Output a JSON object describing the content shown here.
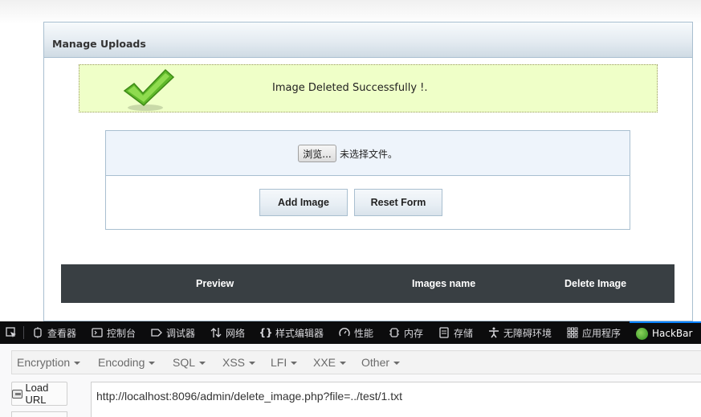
{
  "panel": {
    "title": "Manage Uploads"
  },
  "notification": {
    "message": "Image Deleted Successfully !.",
    "icon": "checkmark-icon"
  },
  "upload_form": {
    "browse_label": "浏览...",
    "no_file_text": "未选择文件。",
    "add_label": "Add Image",
    "reset_label": "Reset Form"
  },
  "table": {
    "columns": [
      "Preview",
      "Images name",
      "Delete Image"
    ]
  },
  "devtools": {
    "items": [
      {
        "label": "查看器",
        "icon": "inspector-icon"
      },
      {
        "label": "控制台",
        "icon": "console-icon"
      },
      {
        "label": "调试器",
        "icon": "debugger-icon"
      },
      {
        "label": "网络",
        "icon": "network-icon"
      },
      {
        "label": "样式编辑器",
        "icon": "style-editor-icon"
      },
      {
        "label": "性能",
        "icon": "performance-icon"
      },
      {
        "label": "内存",
        "icon": "memory-icon"
      },
      {
        "label": "存储",
        "icon": "storage-icon"
      },
      {
        "label": "无障碍环境",
        "icon": "accessibility-icon"
      },
      {
        "label": "应用程序",
        "icon": "application-icon"
      },
      {
        "label": "HackBar",
        "icon": "hackbar-icon"
      }
    ],
    "active_tab": "HackBar"
  },
  "hackbar": {
    "menu": [
      "Encryption",
      "Encoding",
      "SQL",
      "XSS",
      "LFI",
      "XXE",
      "Other"
    ],
    "load_url_label": "Load URL",
    "url_value": "http://localhost:8096/admin/delete_image.php?file=../test/1.txt"
  },
  "colors": {
    "success_bg": "#efffc8",
    "table_header_bg": "#393f43",
    "devtools_bg": "#0c0c0d",
    "devtools_accent": "#0a84ff"
  }
}
